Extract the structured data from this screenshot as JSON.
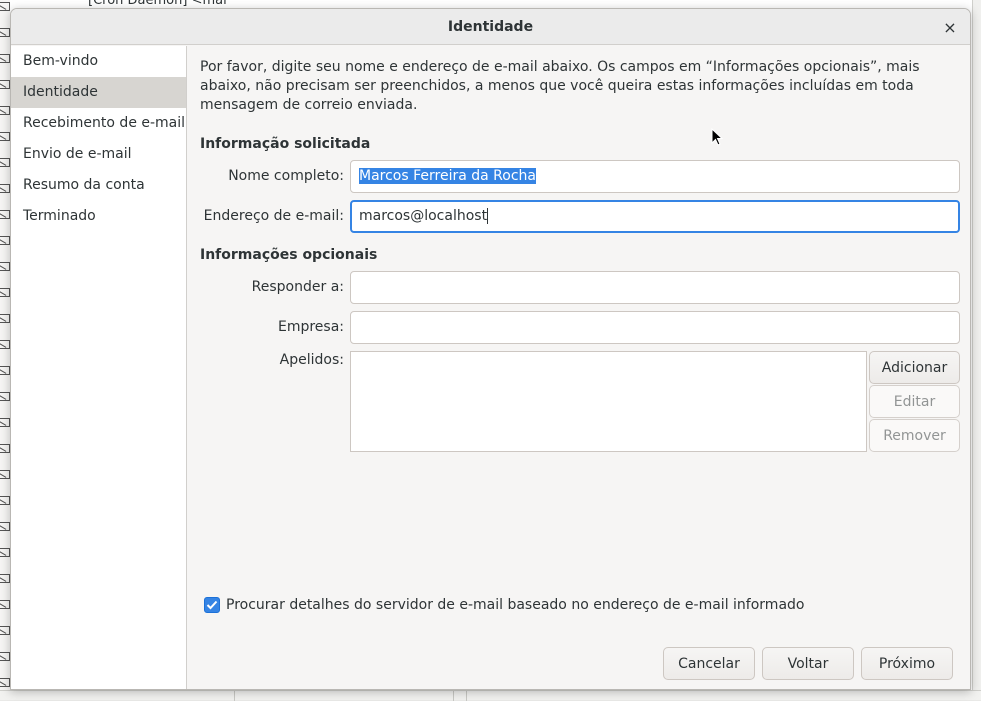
{
  "background": {
    "mail_title_fragment": "[Cron Daemon] <mai"
  },
  "dialog": {
    "title": "Identidade",
    "close_glyph": "×",
    "sidebar": {
      "items": [
        {
          "label": "Bem-vindo",
          "active": false
        },
        {
          "label": "Identidade",
          "active": true
        },
        {
          "label": "Recebimento de e-mail",
          "active": false
        },
        {
          "label": "Envio de e-mail",
          "active": false
        },
        {
          "label": "Resumo da conta",
          "active": false
        },
        {
          "label": "Terminado",
          "active": false
        }
      ]
    },
    "intro_text": "Por favor, digite seu nome e endereço de e-mail abaixo. Os campos em “Informações opcionais”, mais abaixo, não precisam ser preenchidos, a menos que você queira estas informações incluídas em toda mensagem de correio enviada.",
    "required": {
      "heading": "Informação solicitada",
      "full_name_label": "Nome completo:",
      "full_name_value": "Marcos Ferreira da Rocha",
      "email_label": "Endereço de e-mail:",
      "email_value": "marcos@localhost"
    },
    "optional": {
      "heading": "Informações opcionais",
      "reply_to_label": "Responder a:",
      "reply_to_value": "",
      "company_label": "Empresa:",
      "company_value": "",
      "aliases_label": "Apelidos:",
      "add_label": "Adicionar",
      "edit_label": "Editar",
      "remove_label": "Remover"
    },
    "lookup_checkbox": {
      "label": "Procurar detalhes do servidor de e-mail baseado no endereço de e-mail informado",
      "checked": true
    },
    "footer": {
      "cancel_label": "Cancelar",
      "back_label": "Voltar",
      "next_label": "Próximo"
    }
  },
  "colors": {
    "accent": "#3584e4",
    "sidebar_active": "#d7d5d1",
    "dialog_bg": "#f6f5f4"
  }
}
